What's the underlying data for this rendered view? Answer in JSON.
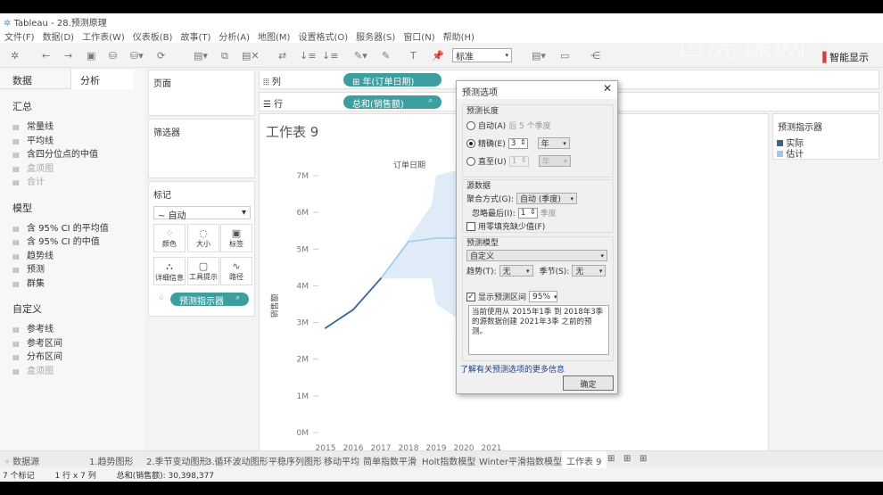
{
  "window": {
    "title": "Tableau - 28.预测原理"
  },
  "menu": [
    "文件(F)",
    "数据(D)",
    "工作表(W)",
    "仪表板(B)",
    "故事(T)",
    "分析(A)",
    "地图(M)",
    "设置格式(O)",
    "服务器(S)",
    "窗口(N)",
    "帮助(H)"
  ],
  "toolbar": {
    "view_select": "标准",
    "show_me": "智能显示"
  },
  "sidebar": {
    "tabs": [
      "数据",
      "分析"
    ],
    "sections": [
      {
        "title": "汇总",
        "items": [
          {
            "label": "常量线",
            "enabled": true
          },
          {
            "label": "平均线",
            "enabled": true
          },
          {
            "label": "含四分位点的中值",
            "enabled": true
          },
          {
            "label": "盒须图",
            "enabled": false
          },
          {
            "label": "合计",
            "enabled": false
          }
        ]
      },
      {
        "title": "模型",
        "items": [
          {
            "label": "含 95% CI 的平均值",
            "enabled": true
          },
          {
            "label": "含 95% CI 的中值",
            "enabled": true
          },
          {
            "label": "趋势线",
            "enabled": true
          },
          {
            "label": "预测",
            "enabled": true
          },
          {
            "label": "群集",
            "enabled": true
          }
        ]
      },
      {
        "title": "自定义",
        "items": [
          {
            "label": "参考线",
            "enabled": true
          },
          {
            "label": "参考区间",
            "enabled": true
          },
          {
            "label": "分布区间",
            "enabled": true
          },
          {
            "label": "盒须图",
            "enabled": false
          }
        ]
      }
    ]
  },
  "cards": {
    "pages": "页面",
    "filters": "筛选器",
    "marks": "标记",
    "mark_type": "自动",
    "mark_buttons": [
      "颜色",
      "大小",
      "标签",
      "详细信息",
      "工具提示",
      "路径"
    ],
    "mark_pill": "预测指示器"
  },
  "shelves": {
    "columns_label": "列",
    "columns_pill": "年(订单日期)",
    "rows_label": "行",
    "rows_pill": "总和(销售额)"
  },
  "sheet": {
    "title": "工作表 9"
  },
  "legend": {
    "title": "预测指示器",
    "items": [
      {
        "label": "实际",
        "color": "#3b6390"
      },
      {
        "label": "估计",
        "color": "#9ec9e8"
      }
    ]
  },
  "chart_data": {
    "type": "line",
    "title": "订单日期",
    "ylabel": "销售额",
    "x": [
      "2015",
      "2016",
      "2017",
      "2018",
      "2019",
      "2020",
      "2021"
    ],
    "yticks": [
      "0M",
      "1M",
      "2M",
      "3M",
      "4M",
      "5M",
      "6M",
      "7M"
    ],
    "ylim": [
      0,
      7000000
    ],
    "series": [
      {
        "name": "实际",
        "color": "#3b6390",
        "x": [
          2015,
          2016,
          2017
        ],
        "values": [
          2850000,
          3350000,
          4200000
        ]
      },
      {
        "name": "估计",
        "color": "#9ec9e8",
        "x": [
          2018,
          2019,
          2020
        ],
        "values": [
          5200000,
          5300000,
          5300000
        ],
        "upper": [
          6200000,
          7000000,
          7200000
        ],
        "lower": [
          4200000,
          3500000,
          3000000
        ]
      }
    ]
  },
  "dialog": {
    "title": "预测选项",
    "length": {
      "title": "预测长度",
      "auto": "自动(A)",
      "auto_hint": "后 5 个季度",
      "exact": "精确(E)",
      "exact_value": "3",
      "exact_unit": "年",
      "until": "直至(U)",
      "until_value": "1",
      "until_unit": "年",
      "selected": "exact"
    },
    "source": {
      "title": "源数据",
      "agg_label": "聚合方式(G):",
      "agg_value": "自动 (季度)",
      "ignore_label": "忽略最后(I):",
      "ignore_value": "1",
      "ignore_unit": "季度",
      "fill_zero": "用零填充缺少值(F)",
      "fill_zero_checked": false
    },
    "model": {
      "title": "预测模型",
      "type": "自定义",
      "trend_label": "趋势(T):",
      "trend_value": "无",
      "season_label": "季节(S):",
      "season_value": "无"
    },
    "interval": {
      "label": "显示预测区间",
      "checked": true,
      "value": "95%"
    },
    "summary": "当前使用从 2015年1季 到 2018年3季 的源数据创建 2021年3季 之前的预测。",
    "link": "了解有关预测选项的更多信息",
    "ok": "确定"
  },
  "tabs": {
    "datasource": "数据源",
    "sheets": [
      "1.趋势图形",
      "2.季节变动图形",
      "3.循环波动图形",
      "平稳序列图形",
      "移动平均",
      "简单指数平滑",
      "Holt指数模型",
      "Winter平滑指数模型",
      "工作表 9"
    ],
    "active": 8
  },
  "status": {
    "marks": "7 个标记",
    "dims": "1 行 x 7 列",
    "sum": "总和(销售额): 30,398,377"
  }
}
